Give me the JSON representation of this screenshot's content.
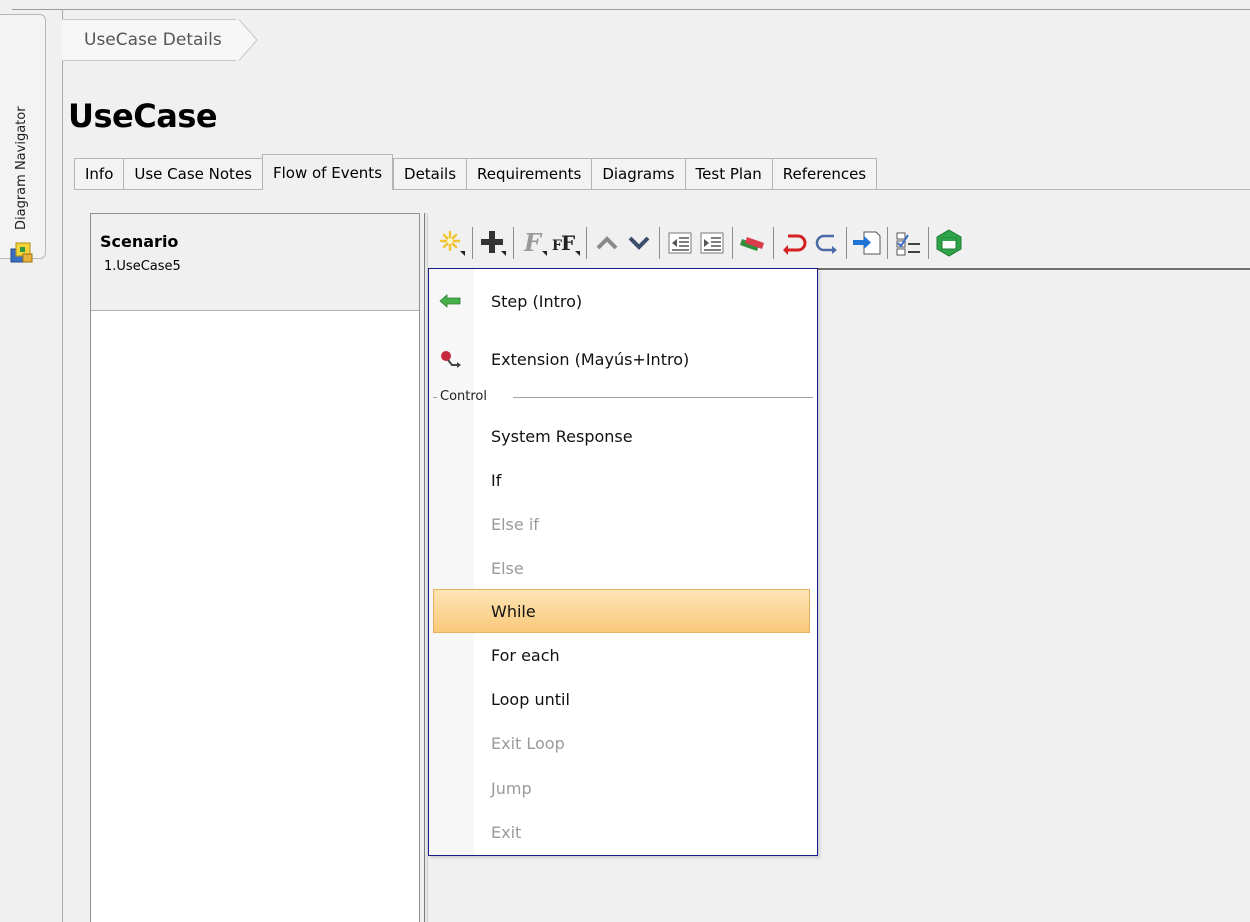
{
  "side_tab": {
    "label": "Diagram Navigator",
    "icon": "diagram-navigator-icon"
  },
  "breadcrumb": {
    "label": "UseCase Details"
  },
  "page": {
    "title": "UseCase"
  },
  "tabs": [
    {
      "label": "Info"
    },
    {
      "label": "Use Case Notes"
    },
    {
      "label": "Flow of Events",
      "active": true
    },
    {
      "label": "Details"
    },
    {
      "label": "Requirements"
    },
    {
      "label": "Diagrams"
    },
    {
      "label": "Test Plan"
    },
    {
      "label": "References"
    }
  ],
  "scenario": {
    "title": "Scenario",
    "item": "1.UseCase5"
  },
  "toolbar": {
    "icons": [
      "sparkle-icon",
      "add-icon",
      "italic-f-icon",
      "ff-format-icon",
      "move-up-icon",
      "move-down-icon",
      "outdent-icon",
      "indent-icon",
      "remove-link-icon",
      "loop-back-icon",
      "loop-icon",
      "insert-step-icon",
      "checklist-icon",
      "open-window-icon"
    ]
  },
  "menu": {
    "items": [
      {
        "label": "Step (Intro)",
        "icon": "green-arrow-left-icon",
        "disabled": false
      },
      {
        "label": "Extension (Mayús+Intro)",
        "icon": "extension-icon",
        "disabled": false
      }
    ],
    "section_label": "Control",
    "control_items": [
      {
        "label": "System Response",
        "disabled": false
      },
      {
        "label": "If",
        "disabled": false
      },
      {
        "label": "Else if",
        "disabled": true
      },
      {
        "label": "Else",
        "disabled": true
      },
      {
        "label": "While",
        "disabled": false,
        "highlighted": true
      },
      {
        "label": "For each",
        "disabled": false
      },
      {
        "label": "Loop until",
        "disabled": false
      },
      {
        "label": "Exit Loop",
        "disabled": true
      },
      {
        "label": "Jump",
        "disabled": true
      },
      {
        "label": "Exit",
        "disabled": true
      }
    ]
  }
}
